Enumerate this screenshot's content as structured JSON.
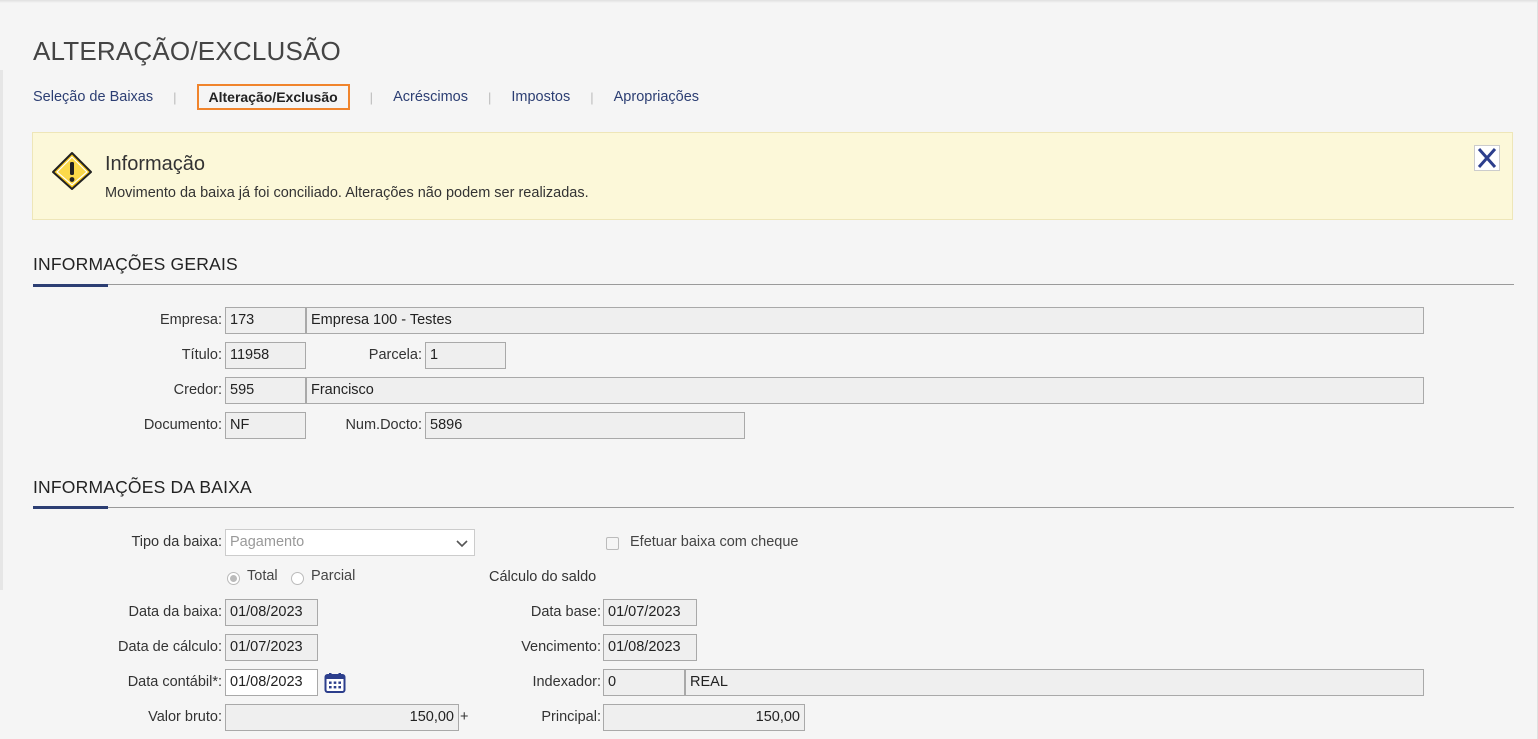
{
  "page": {
    "title": "ALTERAÇÃO/EXCLUSÃO"
  },
  "tabs": [
    {
      "label": "Seleção de Baixas"
    },
    {
      "label": "Alteração/Exclusão",
      "active": true
    },
    {
      "label": "Acréscimos"
    },
    {
      "label": "Impostos"
    },
    {
      "label": "Apropriações"
    }
  ],
  "tab_separator": "|",
  "alert": {
    "title": "Informação",
    "message": "Movimento da baixa já foi conciliado. Alterações não podem ser realizadas.",
    "icon": "warning-icon",
    "close_icon": "close-icon"
  },
  "general": {
    "title": "INFORMAÇÕES GERAIS",
    "empresa_label": "Empresa:",
    "empresa_code": "173",
    "empresa_name": "Empresa 100 - Testes",
    "titulo_label": "Título:",
    "titulo_value": "11958",
    "parcela_label": "Parcela:",
    "parcela_value": "1",
    "credor_label": "Credor:",
    "credor_code": "595",
    "credor_name": "Francisco",
    "documento_label": "Documento:",
    "documento_value": "NF",
    "numdocto_label": "Num.Docto:",
    "numdocto_value": "5896"
  },
  "baixa": {
    "title": "INFORMAÇÕES DA BAIXA",
    "tipo_label": "Tipo da baixa:",
    "tipo_value": "Pagamento",
    "cheque_label": "Efetuar baixa com cheque",
    "radio_total": "Total",
    "radio_parcial": "Parcial",
    "calculo_label": "Cálculo do saldo",
    "data_baixa_label": "Data da baixa:",
    "data_baixa_value": "01/08/2023",
    "data_base_label": "Data base:",
    "data_base_value": "01/07/2023",
    "data_calculo_label": "Data de cálculo:",
    "data_calculo_value": "01/07/2023",
    "vencimento_label": "Vencimento:",
    "vencimento_value": "01/08/2023",
    "data_contabil_label": "Data contábil*:",
    "data_contabil_value": "01/08/2023",
    "indexador_label": "Indexador:",
    "indexador_code": "0",
    "indexador_name": "REAL",
    "valor_bruto_label": "Valor bruto:",
    "valor_bruto_value": "150,00",
    "plus_sign": "+",
    "principal_label": "Principal:",
    "principal_value": "150,00"
  },
  "colors": {
    "accent": "#2c3e73",
    "active_tab_border": "#f0842c",
    "alert_bg": "#fcf8d9"
  }
}
